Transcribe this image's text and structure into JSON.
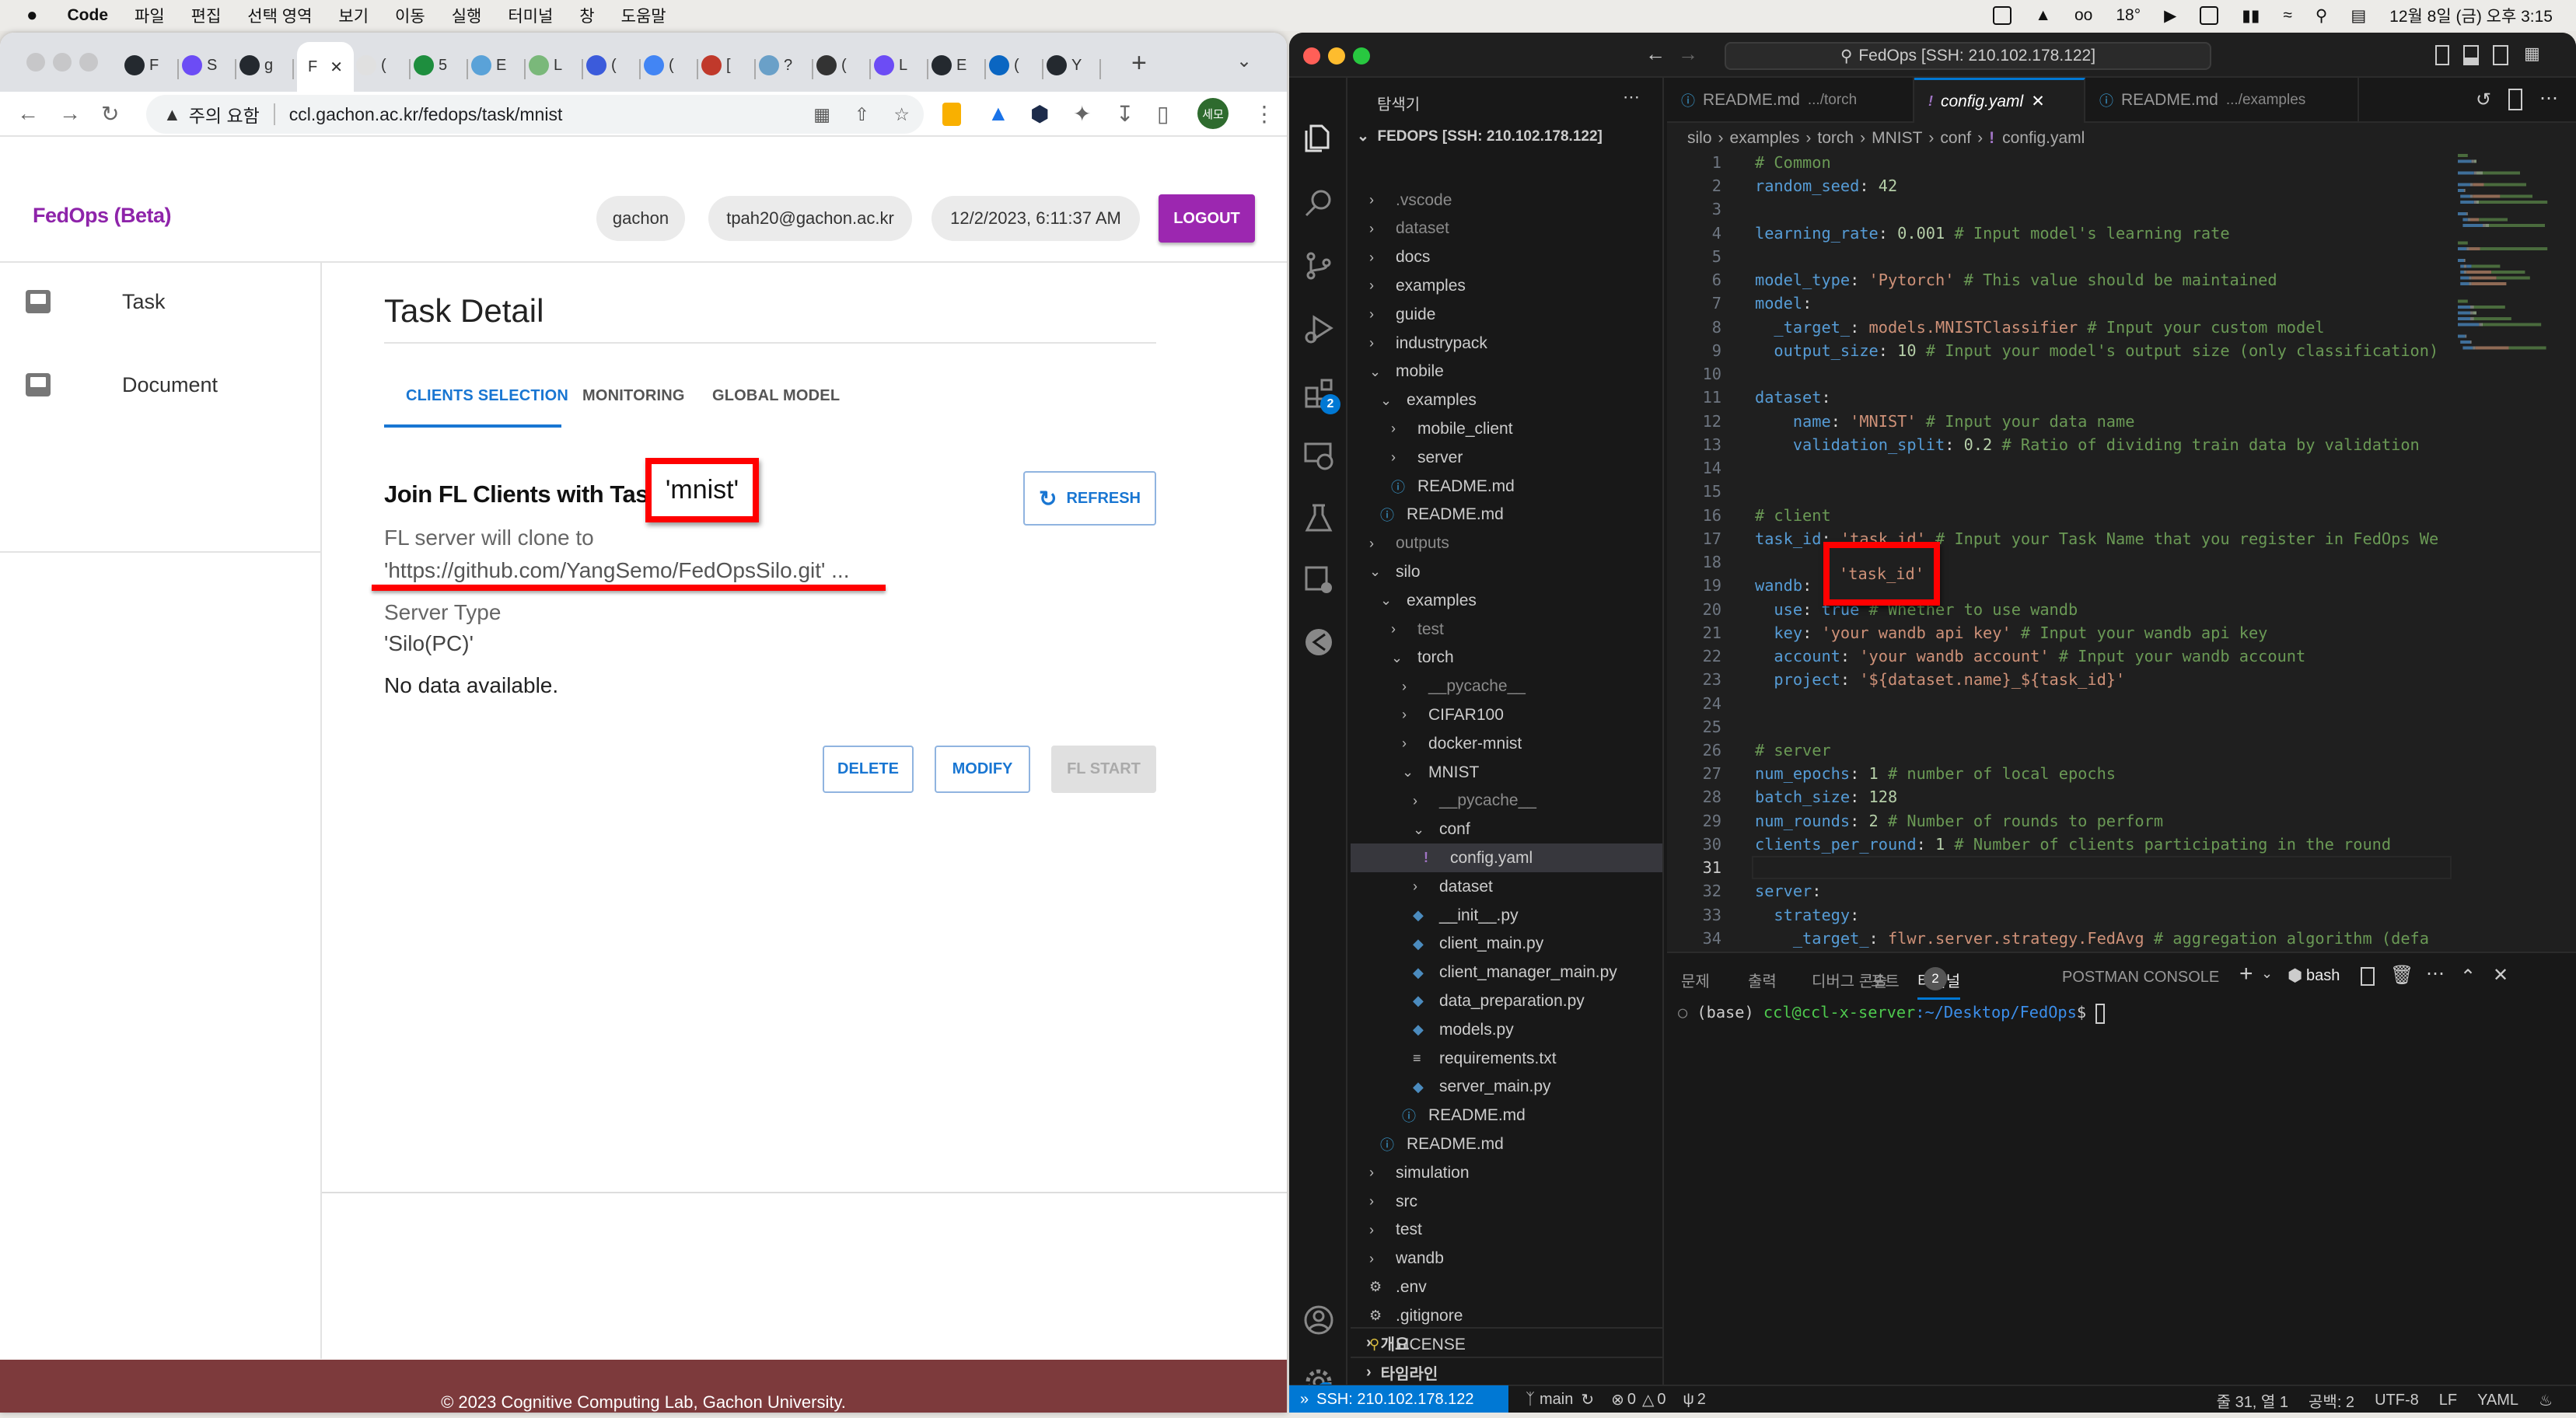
{
  "menubar": {
    "app": "Code",
    "items": [
      "파일",
      "편집",
      "선택 영역",
      "보기",
      "이동",
      "실행",
      "터미널",
      "창",
      "도움말"
    ],
    "weather": "18°",
    "clock": "12월 8일 (금) 오후 3:15"
  },
  "browser": {
    "tabs": [
      "F",
      "S",
      "g",
      "F",
      "(",
      "5",
      "E",
      "L",
      "(",
      "(",
      "[",
      "?",
      "(",
      "L",
      "E",
      "(",
      "Y"
    ],
    "active_tab_index": 3,
    "security_label": "주의 요함",
    "url": "ccl.gachon.ac.kr/fedops/task/mnist",
    "profile": "세모"
  },
  "app": {
    "brand": "FedOps (Beta)",
    "brand_color": "#8e24aa",
    "user": "gachon",
    "email": "tpah20@gachon.ac.kr",
    "datetime": "12/2/2023, 6:11:37 AM",
    "logout": "LOGOUT",
    "nav": [
      {
        "label": "Task",
        "icon": "inbox-icon"
      },
      {
        "label": "Document",
        "icon": "inbox-icon"
      }
    ],
    "title": "Task Detail",
    "tabs": [
      "CLIENTS SELECTION",
      "MONITORING",
      "GLOBAL MODEL"
    ],
    "active_tab": "CLIENTS SELECTION",
    "join_heading": "Join FL Clients with Task ID",
    "task_id": "'mnist'",
    "refresh": "REFRESH",
    "clone_label": "FL server will clone to",
    "clone_url": "'https://github.com/YangSemo/FedOpsSilo.git' ...",
    "server_type_label": "Server Type",
    "server_type": "'Silo(PC)'",
    "no_data": "No data available.",
    "delete": "DELETE",
    "modify": "MODIFY",
    "fl_start": "FL START",
    "footer": "© 2023 Cognitive Computing Lab, Gachon University.",
    "footer_color": "#7d3a3c"
  },
  "vscode": {
    "title": "FedOps [SSH: 210.102.178.122]",
    "explorer_title": "탐색기",
    "root": "FEDOPS [SSH: 210.102.178.122]",
    "activity_badges": {
      "extensions": "2",
      "settings": "1"
    },
    "tree": [
      {
        "name": ".vscode",
        "depth": 1,
        "type": "folder",
        "dim": true
      },
      {
        "name": "dataset",
        "depth": 1,
        "type": "folder",
        "dim": true
      },
      {
        "name": "docs",
        "depth": 1,
        "type": "folder"
      },
      {
        "name": "examples",
        "depth": 1,
        "type": "folder"
      },
      {
        "name": "guide",
        "depth": 1,
        "type": "folder"
      },
      {
        "name": "industrypack",
        "depth": 1,
        "type": "folder"
      },
      {
        "name": "mobile",
        "depth": 1,
        "type": "folder",
        "open": true
      },
      {
        "name": "examples",
        "depth": 2,
        "type": "folder",
        "open": true
      },
      {
        "name": "mobile_client",
        "depth": 3,
        "type": "folder"
      },
      {
        "name": "server",
        "depth": 3,
        "type": "folder"
      },
      {
        "name": "README.md",
        "depth": 3,
        "type": "info"
      },
      {
        "name": "README.md",
        "depth": 2,
        "type": "info"
      },
      {
        "name": "outputs",
        "depth": 1,
        "type": "folder",
        "dim": true
      },
      {
        "name": "silo",
        "depth": 1,
        "type": "folder",
        "open": true
      },
      {
        "name": "examples",
        "depth": 2,
        "type": "folder",
        "open": true
      },
      {
        "name": "test",
        "depth": 3,
        "type": "folder",
        "dim": true
      },
      {
        "name": "torch",
        "depth": 3,
        "type": "folder",
        "open": true
      },
      {
        "name": "__pycache__",
        "depth": 4,
        "type": "folder",
        "dim": true
      },
      {
        "name": "CIFAR100",
        "depth": 4,
        "type": "folder"
      },
      {
        "name": "docker-mnist",
        "depth": 4,
        "type": "folder"
      },
      {
        "name": "MNIST",
        "depth": 4,
        "type": "folder",
        "open": true
      },
      {
        "name": "__pycache__",
        "depth": 5,
        "type": "folder",
        "dim": true
      },
      {
        "name": "conf",
        "depth": 5,
        "type": "folder",
        "open": true
      },
      {
        "name": "config.yaml",
        "depth": 6,
        "type": "yaml",
        "selected": true
      },
      {
        "name": "dataset",
        "depth": 5,
        "type": "folder"
      },
      {
        "name": "__init__.py",
        "depth": 5,
        "type": "py"
      },
      {
        "name": "client_main.py",
        "depth": 5,
        "type": "py"
      },
      {
        "name": "client_manager_main.py",
        "depth": 5,
        "type": "py"
      },
      {
        "name": "data_preparation.py",
        "depth": 5,
        "type": "py"
      },
      {
        "name": "models.py",
        "depth": 5,
        "type": "py"
      },
      {
        "name": "requirements.txt",
        "depth": 5,
        "type": "txt"
      },
      {
        "name": "server_main.py",
        "depth": 5,
        "type": "py"
      },
      {
        "name": "README.md",
        "depth": 4,
        "type": "info"
      },
      {
        "name": "README.md",
        "depth": 2,
        "type": "info"
      },
      {
        "name": "simulation",
        "depth": 1,
        "type": "folder"
      },
      {
        "name": "src",
        "depth": 1,
        "type": "folder"
      },
      {
        "name": "test",
        "depth": 1,
        "type": "folder"
      },
      {
        "name": "wandb",
        "depth": 1,
        "type": "folder"
      },
      {
        "name": ".env",
        "depth": 1,
        "type": "gear"
      },
      {
        "name": ".gitignore",
        "depth": 1,
        "type": "gear"
      },
      {
        "name": "LICENSE",
        "depth": 1,
        "type": "license"
      }
    ],
    "sections": [
      "개요",
      "타임라인"
    ],
    "editor_tabs": [
      {
        "name": "README.md",
        "desc": ".../torch",
        "icon": "info-icon"
      },
      {
        "name": "config.yaml",
        "desc": "",
        "icon": "yaml-icon",
        "active": true
      },
      {
        "name": "README.md",
        "desc": ".../examples",
        "icon": "info-icon"
      }
    ],
    "breadcrumb": [
      "silo",
      "examples",
      "torch",
      "MNIST",
      "conf",
      "config.yaml"
    ],
    "current_line": 31,
    "code": [
      [
        [
          "c",
          "# Common"
        ]
      ],
      [
        [
          "k",
          "random_seed"
        ],
        [
          "p",
          ": "
        ],
        [
          "n",
          "42"
        ]
      ],
      [],
      [
        [
          "k",
          "learning_rate"
        ],
        [
          "p",
          ": "
        ],
        [
          "n",
          "0.001"
        ],
        [
          "c",
          " # Input model's learning rate"
        ]
      ],
      [],
      [
        [
          "k",
          "model_type"
        ],
        [
          "p",
          ": "
        ],
        [
          "s",
          "'Pytorch'"
        ],
        [
          "c",
          " # This value should be maintained"
        ]
      ],
      [
        [
          "k",
          "model"
        ],
        [
          "p",
          ":"
        ]
      ],
      [
        [
          "p",
          "  "
        ],
        [
          "k",
          "_target_"
        ],
        [
          "p",
          ": "
        ],
        [
          "s",
          "models.MNISTClassifier"
        ],
        [
          "c",
          " # Input your custom model"
        ]
      ],
      [
        [
          "p",
          "  "
        ],
        [
          "k",
          "output_size"
        ],
        [
          "p",
          ": "
        ],
        [
          "n",
          "10"
        ],
        [
          "c",
          " # Input your model's output size (only classification)"
        ]
      ],
      [],
      [
        [
          "k",
          "dataset"
        ],
        [
          "p",
          ":"
        ]
      ],
      [
        [
          "p",
          "    "
        ],
        [
          "k",
          "name"
        ],
        [
          "p",
          ": "
        ],
        [
          "s",
          "'MNIST'"
        ],
        [
          "c",
          " # Input your data name"
        ]
      ],
      [
        [
          "p",
          "    "
        ],
        [
          "k",
          "validation_split"
        ],
        [
          "p",
          ": "
        ],
        [
          "n",
          "0.2"
        ],
        [
          "c",
          " # Ratio of dividing train data by validation"
        ]
      ],
      [],
      [],
      [
        [
          "c",
          "# client"
        ]
      ],
      [
        [
          "k",
          "task_id"
        ],
        [
          "p",
          ": "
        ],
        [
          "s",
          "'task_id'"
        ],
        [
          "c",
          " # Input your Task Name that you register in FedOps We"
        ]
      ],
      [],
      [
        [
          "k",
          "wandb"
        ],
        [
          "p",
          ":"
        ]
      ],
      [
        [
          "p",
          "  "
        ],
        [
          "k",
          "use"
        ],
        [
          "p",
          ": "
        ],
        [
          "b",
          "true"
        ],
        [
          "c",
          " # Whether to use wandb"
        ]
      ],
      [
        [
          "p",
          "  "
        ],
        [
          "k",
          "key"
        ],
        [
          "p",
          ": "
        ],
        [
          "s",
          "'your wandb api key'"
        ],
        [
          "c",
          " # Input your wandb api key"
        ]
      ],
      [
        [
          "p",
          "  "
        ],
        [
          "k",
          "account"
        ],
        [
          "p",
          ": "
        ],
        [
          "s",
          "'your wandb account'"
        ],
        [
          "c",
          " # Input your wandb account"
        ]
      ],
      [
        [
          "p",
          "  "
        ],
        [
          "k",
          "project"
        ],
        [
          "p",
          ": "
        ],
        [
          "s",
          "'${dataset.name}_${task_id}'"
        ]
      ],
      [],
      [],
      [
        [
          "c",
          "# server"
        ]
      ],
      [
        [
          "k",
          "num_epochs"
        ],
        [
          "p",
          ": "
        ],
        [
          "n",
          "1"
        ],
        [
          "c",
          " # number of local epochs"
        ]
      ],
      [
        [
          "k",
          "batch_size"
        ],
        [
          "p",
          ": "
        ],
        [
          "n",
          "128"
        ]
      ],
      [
        [
          "k",
          "num_rounds"
        ],
        [
          "p",
          ": "
        ],
        [
          "n",
          "2"
        ],
        [
          "c",
          " # Number of rounds to perform"
        ]
      ],
      [
        [
          "k",
          "clients_per_round"
        ],
        [
          "p",
          ": "
        ],
        [
          "n",
          "1"
        ],
        [
          "c",
          " # Number of clients participating in the round"
        ]
      ],
      [],
      [
        [
          "k",
          "server"
        ],
        [
          "p",
          ":"
        ]
      ],
      [
        [
          "p",
          "  "
        ],
        [
          "k",
          "strategy"
        ],
        [
          "p",
          ":"
        ]
      ],
      [
        [
          "p",
          "    "
        ],
        [
          "k",
          "_target_"
        ],
        [
          "p",
          ": "
        ],
        [
          "s",
          "flwr.server.strategy.FedAvg"
        ],
        [
          "c",
          " # aggregation algorithm (defa"
        ]
      ]
    ],
    "highlight_value": "'task_id'",
    "panel_tabs": [
      "문제",
      "출력",
      "디버그 콘솔",
      "터미널",
      "포트",
      "POSTMAN CONSOLE"
    ],
    "active_panel_tab": "터미널",
    "ports_badge": "2",
    "shell": "bash",
    "terminal": {
      "prefix": "(base) ",
      "user": "ccl@ccl-x-server",
      "path": ":~/Desktop/FedOps",
      "prompt": "$ "
    },
    "status": {
      "remote": "SSH: 210.102.178.122",
      "branch": "main",
      "errors": "0",
      "warnings": "0",
      "ports": "2",
      "position": "줄 31, 열 1",
      "spaces": "공백: 2",
      "encoding": "UTF-8",
      "eol": "LF",
      "language": "YAML"
    }
  }
}
